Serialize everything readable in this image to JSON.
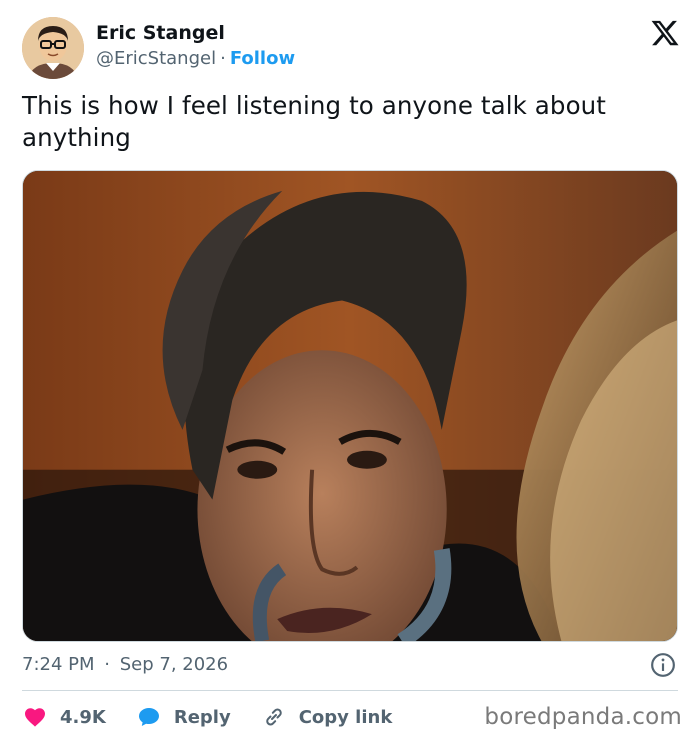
{
  "author": {
    "name": "Eric Stangel",
    "handle": "@EricStangel",
    "separator": "·",
    "follow_label": "Follow"
  },
  "platform_icon": "x-logo-icon",
  "tweet": {
    "text": "This is how I feel listening to anyone talk about anything"
  },
  "media": {
    "type": "photo",
    "icon": "photo"
  },
  "meta": {
    "time": "7:24 PM",
    "separator": "·",
    "date": "Sep 7, 2026",
    "info_icon": "info-icon"
  },
  "actions": {
    "likes": {
      "icon": "heart-icon",
      "label": "4.9K",
      "color": "#f91880"
    },
    "reply": {
      "icon": "reply-bubble-icon",
      "label": "Reply",
      "color": "#1d9bf0"
    },
    "copy": {
      "icon": "link-icon",
      "label": "Copy link"
    }
  },
  "watermark": "boredpanda.com",
  "colors": {
    "accent": "#1d9bf0",
    "text": "#0f1419",
    "secondary": "#536471",
    "divider": "#cfd9de"
  }
}
